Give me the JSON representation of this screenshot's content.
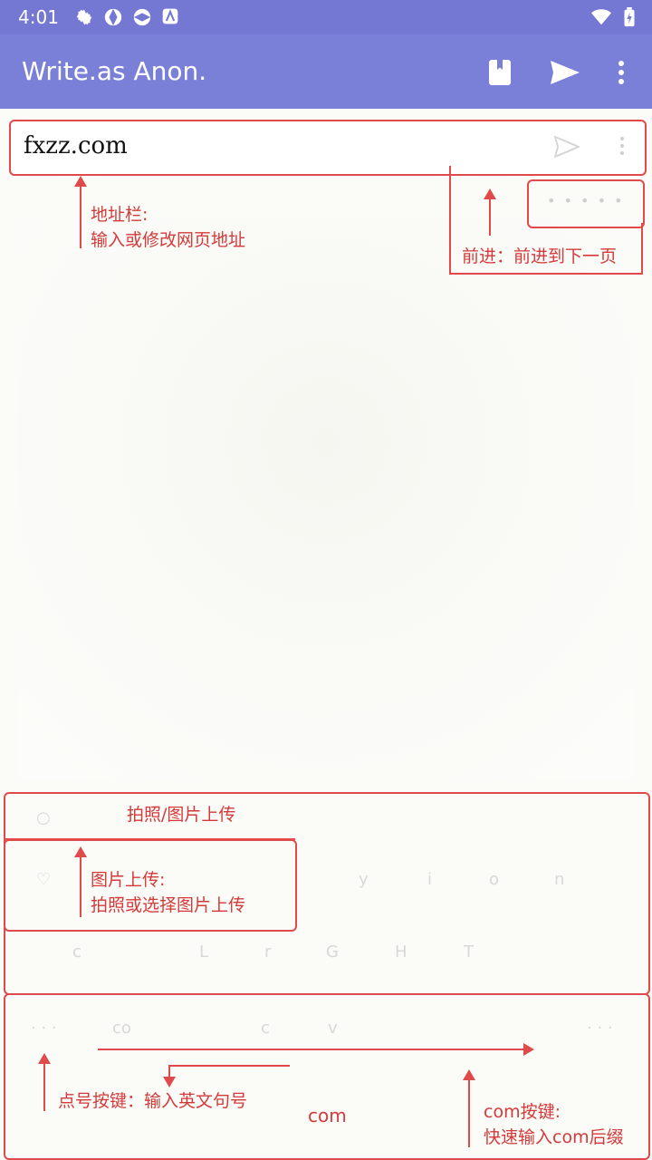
{
  "status": {
    "time": "4:01"
  },
  "appbar": {
    "title": "Write.as Anon."
  },
  "address": {
    "value": "fxzz.com"
  },
  "forward": {
    "dots": "• • • • •"
  },
  "annotations": {
    "address_title": "地址栏:",
    "address_desc": "输入或修改网页地址",
    "forward": "前进：前进到下一页",
    "camera_upload": "拍照/图片上传",
    "image_title": "图片上传:",
    "image_desc": "拍照或选择图片上传",
    "dot_key": "点号按键：输入英文句号",
    "com_label": "com",
    "com_title": "com按键:",
    "com_desc": "快速输入com后缀"
  },
  "keyboard_faint": {
    "row1": [
      "y",
      "i",
      "o",
      "n"
    ],
    "row2": [
      "c",
      "L",
      "r",
      "G",
      "H",
      "T"
    ],
    "row3": [
      "· · ·",
      "co",
      "c",
      "v",
      "· · ·"
    ]
  },
  "colors": {
    "appbar": "#7a7fd8",
    "statusbar": "#7478d3",
    "annotation": "#e04a4a"
  }
}
